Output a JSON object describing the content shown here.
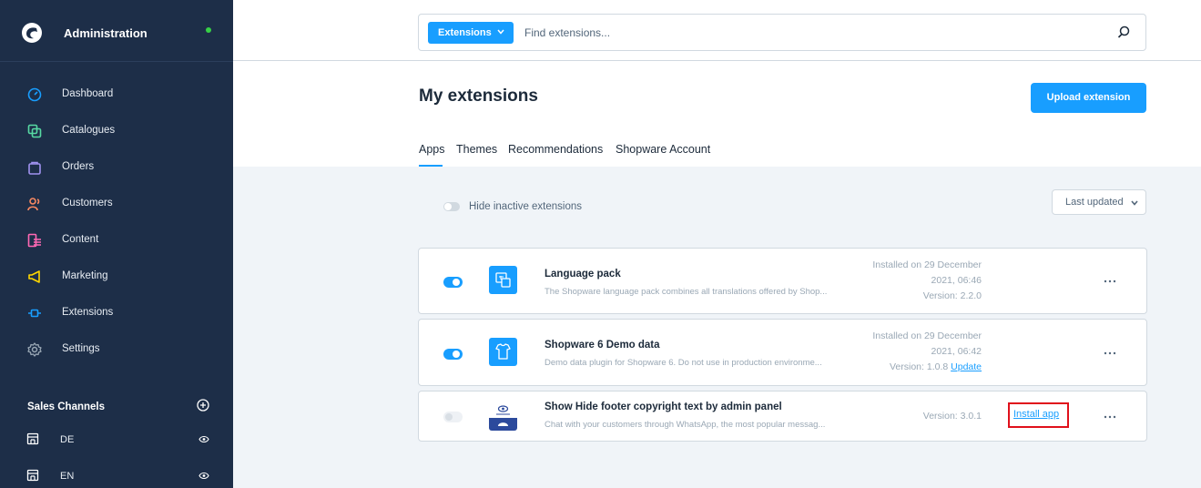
{
  "colors": {
    "sidebar_bg": "#1d2e48",
    "accent": "#189eff",
    "status_online": "#37d046",
    "highlight": "#e0101b"
  },
  "sidebar": {
    "title": "Administration",
    "items": [
      {
        "label": "Dashboard",
        "icon": "dashboard-icon",
        "color": "#189eff"
      },
      {
        "label": "Catalogues",
        "icon": "catalogues-icon",
        "color": "#57d9a3"
      },
      {
        "label": "Orders",
        "icon": "orders-icon",
        "color": "#a092f0"
      },
      {
        "label": "Customers",
        "icon": "customers-icon",
        "color": "#f88962"
      },
      {
        "label": "Content",
        "icon": "content-icon",
        "color": "#ff68b4"
      },
      {
        "label": "Marketing",
        "icon": "marketing-icon",
        "color": "#ffd700"
      },
      {
        "label": "Extensions",
        "icon": "extensions-icon",
        "color": "#189eff"
      },
      {
        "label": "Settings",
        "icon": "settings-icon",
        "color": "#9aa8b5"
      }
    ],
    "sales_channels_title": "Sales Channels",
    "channels": [
      {
        "label": "DE"
      },
      {
        "label": "EN"
      }
    ]
  },
  "search": {
    "type_label": "Extensions",
    "placeholder": "Find extensions..."
  },
  "page": {
    "title": "My extensions",
    "upload_label": "Upload extension",
    "tabs": [
      {
        "label": "Apps",
        "active": true
      },
      {
        "label": "Themes"
      },
      {
        "label": "Recommendations"
      },
      {
        "label": "Shopware Account"
      }
    ],
    "hide_inactive_label": "Hide inactive extensions",
    "sort_label": "Last updated"
  },
  "extensions": [
    {
      "name": "Language pack",
      "description": "The Shopware language pack combines all translations offered by Shop...",
      "installed_line1": "Installed on 29 December",
      "installed_line2": "2021, 06:46",
      "version": "Version: 2.2.0",
      "active": true
    },
    {
      "name": "Shopware 6 Demo data",
      "description": "Demo data plugin for Shopware 6. Do not use in production environme...",
      "installed_line1": "Installed on 29 December",
      "installed_line2": "2021, 06:42",
      "version": "Version: 1.0.8",
      "update_label": "Update",
      "active": true
    },
    {
      "name": "Show Hide footer copyright text by admin panel",
      "description": "Chat with your customers through WhatsApp, the most popular messag...",
      "version": "Version: 3.0.1",
      "install_label": "Install app",
      "active": false
    }
  ]
}
